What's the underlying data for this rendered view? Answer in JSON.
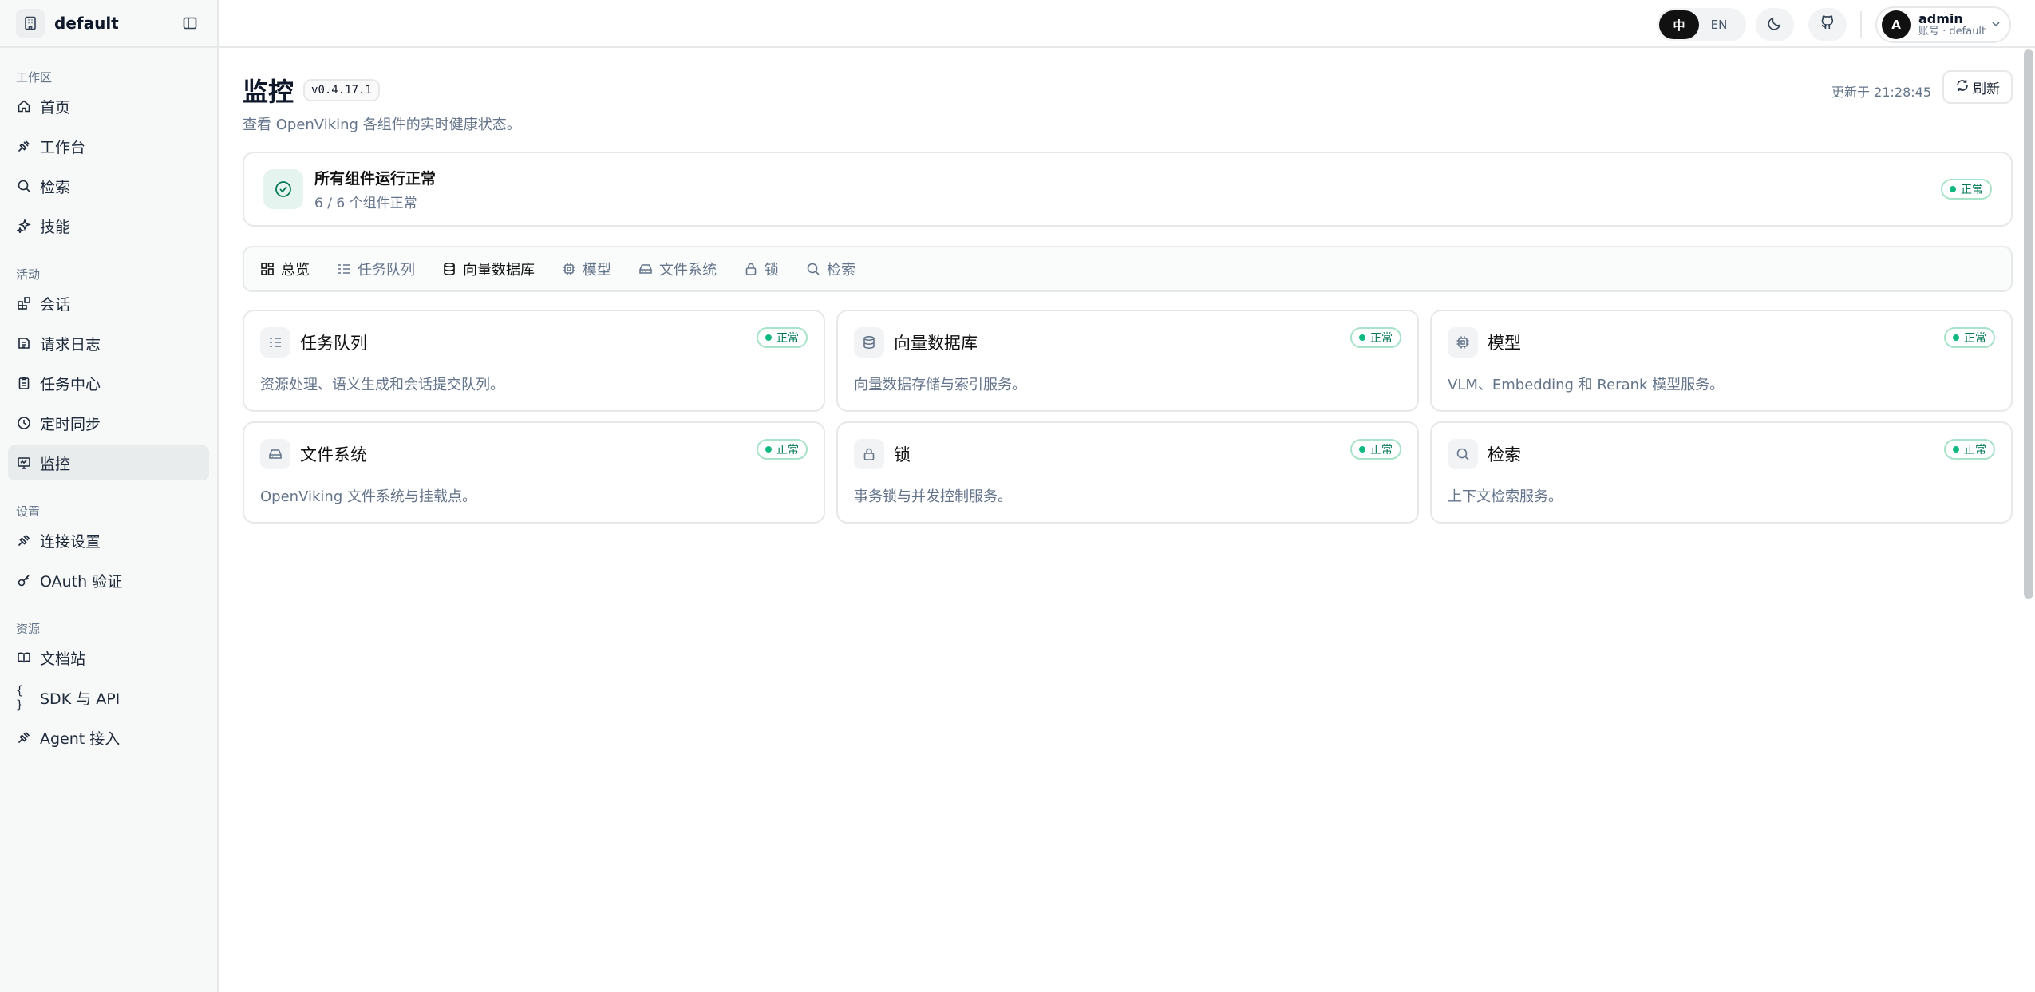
{
  "sidebar": {
    "workspace": "default",
    "groups": [
      {
        "label": "工作区"
      },
      {
        "label": "活动"
      },
      {
        "label": "设置"
      },
      {
        "label": "资源"
      }
    ],
    "items": [
      {
        "label": "首页"
      },
      {
        "label": "工作台"
      },
      {
        "label": "检索"
      },
      {
        "label": "技能"
      },
      {
        "label": "会话"
      },
      {
        "label": "请求日志"
      },
      {
        "label": "任务中心"
      },
      {
        "label": "定时同步"
      },
      {
        "label": "监控"
      },
      {
        "label": "连接设置"
      },
      {
        "label": "OAuth 验证"
      },
      {
        "label": "文档站"
      },
      {
        "label": "SDK 与 API"
      },
      {
        "label": "Agent 接入"
      }
    ]
  },
  "topbar": {
    "lang_zh": "中",
    "lang_en": "EN",
    "user_initial": "A",
    "user_name": "admin",
    "user_sub": "账号 · default"
  },
  "page": {
    "title": "监控",
    "version": "v0.4.17.1",
    "subtitle": "查看 OpenViking 各组件的实时健康状态。",
    "updated": "更新于 21:28:45",
    "refresh": "刷新"
  },
  "summary": {
    "title": "所有组件运行正常",
    "sub": "6 / 6 个组件正常",
    "badge": "正常"
  },
  "tabs": [
    {
      "label": "总览"
    },
    {
      "label": "任务队列"
    },
    {
      "label": "向量数据库"
    },
    {
      "label": "模型"
    },
    {
      "label": "文件系统"
    },
    {
      "label": "锁"
    },
    {
      "label": "检索"
    }
  ],
  "cards": [
    {
      "title": "任务队列",
      "desc": "资源处理、语义生成和会话提交队列。",
      "badge": "正常"
    },
    {
      "title": "向量数据库",
      "desc": "向量数据存储与索引服务。",
      "badge": "正常"
    },
    {
      "title": "模型",
      "desc": "VLM、Embedding 和 Rerank 模型服务。",
      "badge": "正常"
    },
    {
      "title": "文件系统",
      "desc": "OpenViking 文件系统与挂载点。",
      "badge": "正常"
    },
    {
      "title": "锁",
      "desc": "事务锁与并发控制服务。",
      "badge": "正常"
    },
    {
      "title": "检索",
      "desc": "上下文检索服务。",
      "badge": "正常"
    }
  ],
  "colors": {
    "accent": "#10b981",
    "badge_text": "#047857",
    "muted": "#64748b"
  }
}
